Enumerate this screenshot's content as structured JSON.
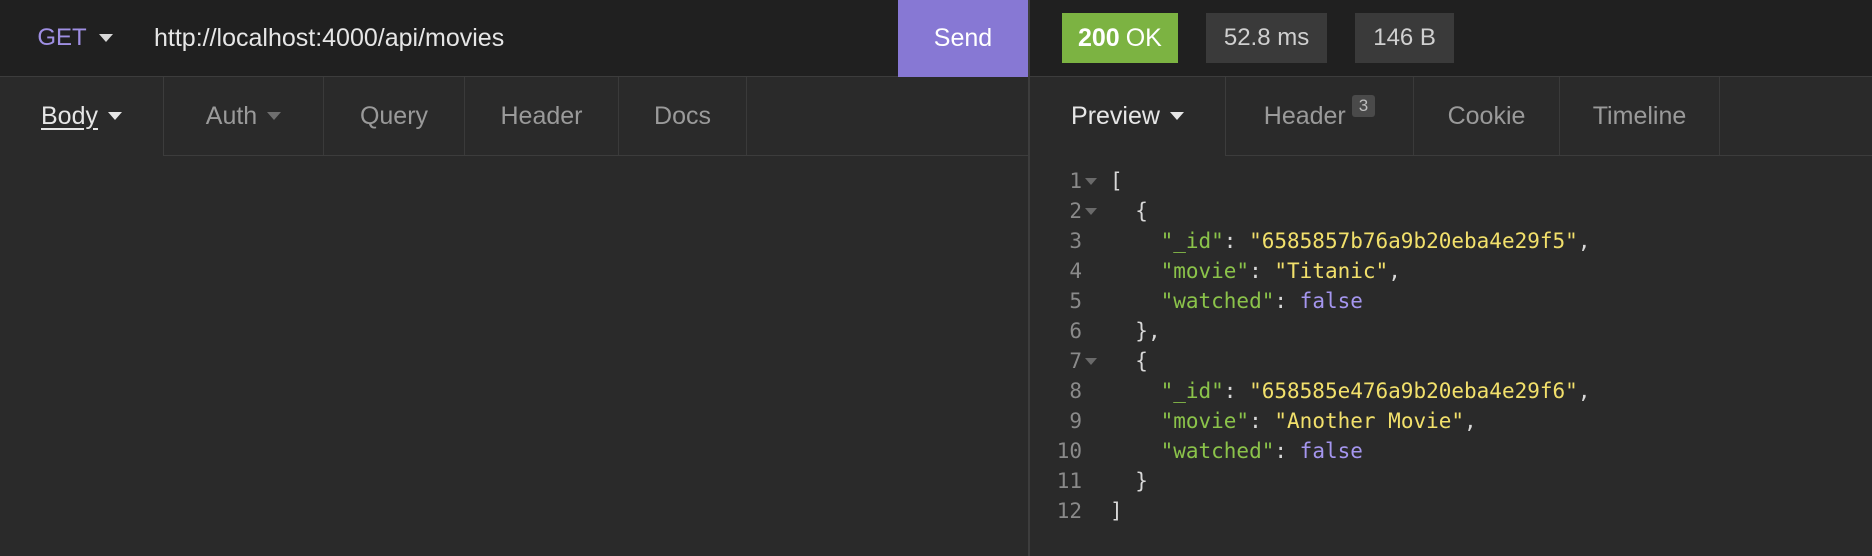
{
  "request": {
    "method": "GET",
    "url": "http://localhost:4000/api/movies",
    "send_label": "Send",
    "tabs": [
      {
        "label": "Body"
      },
      {
        "label": "Auth"
      },
      {
        "label": "Query"
      },
      {
        "label": "Header"
      },
      {
        "label": "Docs"
      }
    ]
  },
  "response": {
    "status_code": "200",
    "status_text": "OK",
    "time": "52.8 ms",
    "size": "146 B",
    "tabs": [
      {
        "label": "Preview"
      },
      {
        "label": "Header",
        "count": "3"
      },
      {
        "label": "Cookie"
      },
      {
        "label": "Timeline"
      }
    ],
    "json": {
      "line_numbers": [
        "1",
        "2",
        "3",
        "4",
        "5",
        "6",
        "7",
        "8",
        "9",
        "10",
        "11",
        "12"
      ],
      "open_bracket": "[",
      "close_bracket": "]",
      "open_brace": "{",
      "close_brace_comma": "},",
      "close_brace": "}",
      "items": [
        {
          "id_key": "\"_id\"",
          "id_value": "\"6585857b76a9b20eba4e29f5\"",
          "movie_key": "\"movie\"",
          "movie_value": "\"Titanic\"",
          "watched_key": "\"watched\"",
          "watched_value": "false"
        },
        {
          "id_key": "\"_id\"",
          "id_value": "\"658585e476a9b20eba4e29f6\"",
          "movie_key": "\"movie\"",
          "movie_value": "\"Another Movie\"",
          "watched_key": "\"watched\"",
          "watched_value": "false"
        }
      ]
    }
  },
  "colors": {
    "accent": "#8778d4",
    "status_ok": "#7cb342",
    "json_key": "#8bc34a",
    "json_string": "#f2e06b",
    "json_boolean": "#a596ef"
  }
}
